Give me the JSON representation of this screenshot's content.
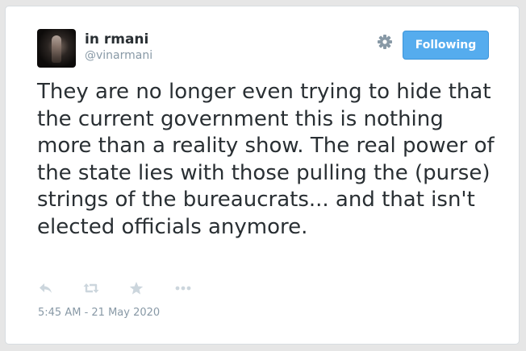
{
  "user": {
    "display_name": "in rmani",
    "handle": "@vinarmani",
    "avatar_icon": "profile-photo"
  },
  "header": {
    "settings_icon": "gear-icon",
    "follow_button_label": "Following"
  },
  "tweet": {
    "text": "They are no longer even trying to hide that the current government this is nothing more than a reality show. The real power of the state lies with those pulling the (purse) strings of the bureaucrats... and that isn't elected officials anymore.",
    "timestamp": "5:45 AM - 21 May 2020"
  },
  "actions": [
    {
      "icon": "reply-icon"
    },
    {
      "icon": "retweet-icon"
    },
    {
      "icon": "favorite-star-icon"
    },
    {
      "icon": "more-dots-icon"
    }
  ],
  "colors": {
    "accent": "#55acee",
    "text": "#292f33",
    "muted": "#8899a6",
    "icon": "#ccd6dd"
  }
}
